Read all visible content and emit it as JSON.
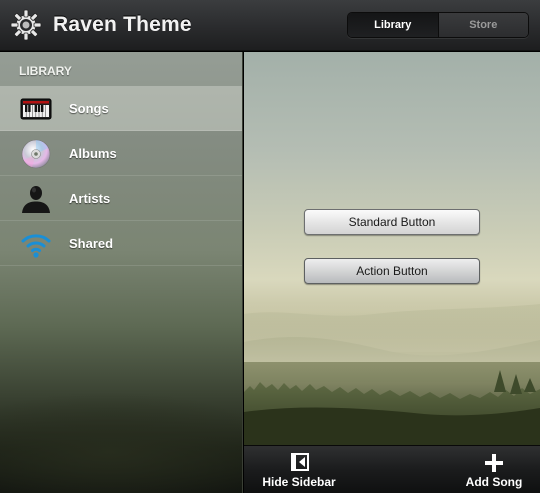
{
  "app": {
    "title": "Raven Theme",
    "icon": "gear-icon"
  },
  "segmented": {
    "items": [
      {
        "label": "Library",
        "active": true
      },
      {
        "label": "Store",
        "active": false
      }
    ]
  },
  "sidebar": {
    "header": "LIBRARY",
    "items": [
      {
        "label": "Songs",
        "icon": "piano-keyboard-icon",
        "selected": true
      },
      {
        "label": "Albums",
        "icon": "cd-disc-icon",
        "selected": false
      },
      {
        "label": "Artists",
        "icon": "person-silhouette-icon",
        "selected": false
      },
      {
        "label": "Shared",
        "icon": "wifi-signal-icon",
        "selected": false
      }
    ]
  },
  "main": {
    "standard_button": "Standard Button",
    "action_button": "Action Button"
  },
  "toolbar": {
    "hide_sidebar": "Hide Sidebar",
    "add_song": "Add Song"
  },
  "colors": {
    "accent_wifi": "#1a8fd6",
    "titlebar": "#2a2b2d",
    "toolbar": "#1b1c1d"
  }
}
